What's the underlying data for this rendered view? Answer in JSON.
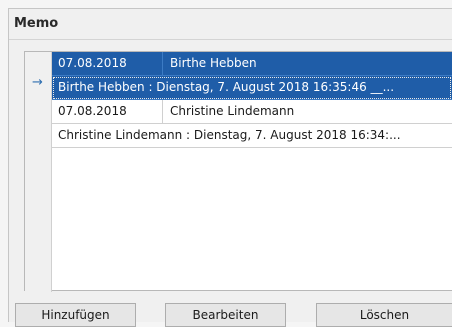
{
  "panel": {
    "title": "Memo"
  },
  "grid": {
    "indicator_glyph": "→",
    "rows": [
      {
        "date": "07.08.2018",
        "name": "Birthe Hebben"
      },
      {
        "memo": "Birthe Hebben : Dienstag, 7. August 2018 16:35:46 __..."
      },
      {
        "date": "07.08.2018",
        "name": "Christine Lindemann"
      },
      {
        "memo": "Christine Lindemann : Dienstag, 7. August 2018 16:34:..."
      }
    ]
  },
  "buttons": {
    "add": "Hinzufügen",
    "edit": "Bearbeiten",
    "delete": "Löschen"
  }
}
